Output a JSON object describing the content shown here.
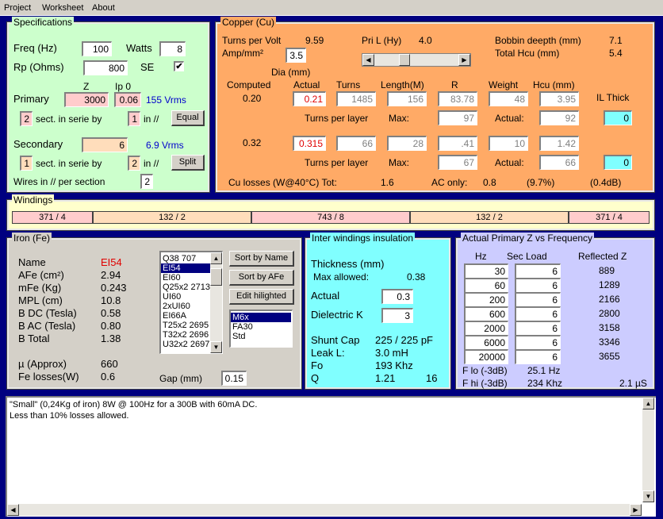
{
  "menu": {
    "items": [
      "Project",
      "Worksheet",
      "About"
    ]
  },
  "spec": {
    "title": "Specifications",
    "freq_label": "Freq (Hz)",
    "freq": "100",
    "watts_label": "Watts",
    "watts": "8",
    "rp_label": "Rp (Ohms)",
    "rp": "800",
    "se_label": "SE",
    "se_checked": "✔",
    "z_label": "Z",
    "ip0_label": "Ip 0",
    "primary_label": "Primary",
    "primary_z": "3000",
    "primary_ip0": "0.06",
    "primary_vrms": "155 Vrms",
    "p_sect": "2",
    "p_sect_label": "sect. in serie by",
    "p_par": "1",
    "p_par_label": "in //",
    "equal_btn": "Equal",
    "secondary_label": "Secondary",
    "secondary_z": "6",
    "secondary_vrms": "6.9 Vrms",
    "s_sect": "1",
    "s_sect_label": "sect. in serie by",
    "s_par": "2",
    "s_par_label": "in //",
    "split_btn": "Split",
    "wires_label": "Wires in // per section",
    "wires": "2"
  },
  "copper": {
    "title": "Copper (Cu)",
    "tpv_label": "Turns per Volt",
    "tpv": "9.59",
    "pril_label": "Pri L (Hy)",
    "pril": "4.0",
    "bobbin_label": "Bobbin deepth (mm)",
    "bobbin": "7.1",
    "amp_label": "Amp/mm²",
    "amp": "3.5",
    "total_hcu_label": "Total Hcu (mm)",
    "total_hcu": "5.4",
    "slider_value": 0.34,
    "dia_label": "Dia (mm)",
    "computed_label": "Computed",
    "actual_label": "Actual",
    "turns_label": "Turns",
    "length_label": "Length(M)",
    "r_label": "R",
    "weight_label": "Weight",
    "hcu_label": "Hcu (mm)",
    "il_label": "IL Thick",
    "p_computed": "0.20",
    "p_actual": "0.21",
    "p_turns": "1485",
    "p_length": "156",
    "p_r": "83.78",
    "p_weight": "48",
    "p_hcu": "3.95",
    "tpl_label": "Turns per layer",
    "max_label": "Max:",
    "actual2_label": "Actual:",
    "p_max": "97",
    "p_tpl_actual": "92",
    "p_il": "0",
    "s_computed": "0.32",
    "s_actual": "0.315",
    "s_turns": "66",
    "s_length": "28",
    "s_r": ".41",
    "s_weight": "10",
    "s_hcu": "1.42",
    "s_max": "67",
    "s_tpl_actual": "66",
    "s_il": "0",
    "losses_label": "Cu losses (W@40°C) Tot:",
    "losses_tot": "1.6",
    "ac_label": "AC only:",
    "ac_val": "0.8",
    "ac_pct": "(9.7%)",
    "ac_db": "(0.4dB)"
  },
  "windings": {
    "title": "Windings",
    "segments": [
      "371 / 4",
      "132 / 2",
      "743 / 8",
      "132 / 2",
      "371 / 4"
    ]
  },
  "iron": {
    "title": "Iron (Fe)",
    "rows": [
      {
        "label": "Name",
        "value": "EI54"
      },
      {
        "label": "AFe (cm²)",
        "value": "2.94"
      },
      {
        "label": "mFe (Kg)",
        "value": "0.243"
      },
      {
        "label": "MPL (cm)",
        "value": "10.8"
      },
      {
        "label": "B DC (Tesla)",
        "value": "0.58"
      },
      {
        "label": "B AC (Tesla)",
        "value": "0.80"
      },
      {
        "label": "B Total",
        "value": "1.38"
      }
    ],
    "mu_label": "µ (Approx)",
    "mu": "660",
    "fe_label": "Fe losses(W)",
    "fe": "0.6",
    "gap_label": "Gap (mm)",
    "gap": "0.15",
    "cores": [
      "Q38  707",
      "EI54",
      "EI60",
      "Q25x2  2713",
      "UI60",
      "2xUI60",
      "EI66A",
      "T25x2  2695",
      "T32x2  2696",
      "U32x2  2697"
    ],
    "selected_core": 1,
    "sort_name_btn": "Sort by Name",
    "sort_afe_btn": "Sort by AFe",
    "edit_btn": "Edit hilighted",
    "materials": [
      "M6x",
      "FA30",
      "Std"
    ],
    "selected_material": 0
  },
  "insul": {
    "title": "Inter windings insulation",
    "thickness_label": "Thickness (mm)",
    "max_label": "Max allowed:",
    "max": "0.38",
    "actual_label": "Actual",
    "actual": "0.3",
    "dk_label": "Dielectric K",
    "dk": "3",
    "shunt_label": "Shunt Cap",
    "shunt": "225 / 225 pF",
    "leak_label": "Leak L:",
    "leak": "3.0 mH",
    "fo_label": "Fo",
    "fo": "193 Khz",
    "q_label": "Q",
    "q": "1.21",
    "q2": "16"
  },
  "freq": {
    "title": "Actual Primary Z vs Frequency",
    "hz_label": "Hz",
    "load_label": "Sec Load",
    "refl_label": "Reflected Z",
    "rows": [
      {
        "hz": "30",
        "load": "6",
        "z": "889"
      },
      {
        "hz": "60",
        "load": "6",
        "z": "1289"
      },
      {
        "hz": "200",
        "load": "6",
        "z": "2166"
      },
      {
        "hz": "600",
        "load": "6",
        "z": "2800"
      },
      {
        "hz": "2000",
        "load": "6",
        "z": "3158"
      },
      {
        "hz": "6000",
        "load": "6",
        "z": "3346"
      },
      {
        "hz": "20000",
        "load": "6",
        "z": "3655"
      }
    ],
    "flo_label": "F lo (-3dB)",
    "flo": "25.1 Hz",
    "fhi_label": "F hi (-3dB)",
    "fhi": "234 Khz",
    "rise": "2.1 µS"
  },
  "notes": {
    "line1": "\"Small\" (0,24Kg of iron) 8W @ 100Hz for a 300B with 60mA DC.",
    "line2": "Less than 10% losses allowed."
  },
  "colors": {
    "background": "#000080",
    "spec_panel": "#ccffcc",
    "copper_panel": "#ffaa66",
    "windings_panel": "#ffffcc",
    "iron_panel": "#d4d0c8",
    "insul_panel": "#80ffff",
    "freq_panel": "#ccccff"
  }
}
